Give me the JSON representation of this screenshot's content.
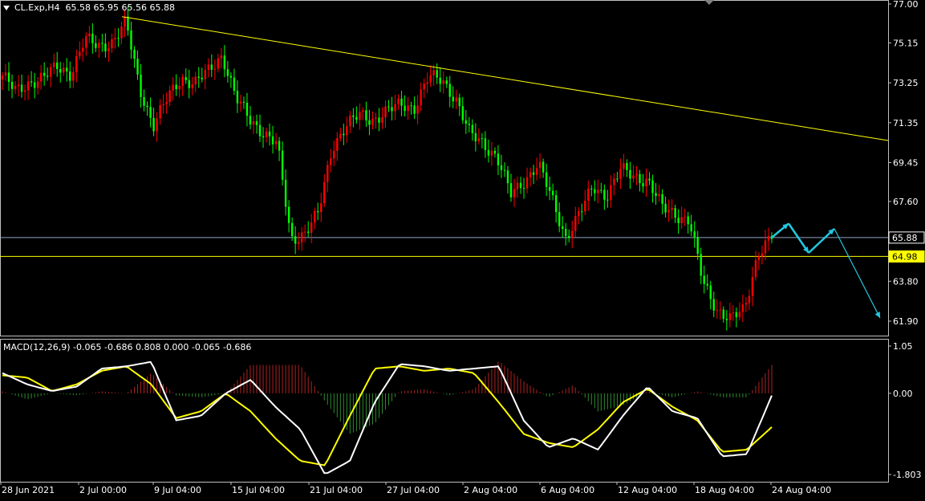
{
  "header": {
    "symbol": "CL.Exp,H4",
    "ohlc": "65.58 65.95 65.56 65.88"
  },
  "macd_header": "MACD(12,26,9) -0.065 -0.686 0.808 0.000 -0.065 -0.686",
  "colors": {
    "background": "#000000",
    "bull_candle": "#ff0000",
    "bear_candle": "#00ff00",
    "trendline": "#ffff00",
    "support_line": "#ffff00",
    "price_line": "#8fa4c4",
    "forecast_arrow": "#22c8e0",
    "macd_line": "#ffffff",
    "signal_line": "#ffff00",
    "hist_pos": "#b22222",
    "hist_neg": "#2e8b2e"
  },
  "price_badges": {
    "current": "65.88",
    "support": "64.98"
  },
  "chart_data": [
    {
      "type": "candlestick",
      "title": "CL.Exp,H4",
      "y_ticks": [
        "77.00",
        "75.15",
        "73.25",
        "71.35",
        "69.45",
        "67.60",
        "63.80",
        "61.90"
      ],
      "ylim": [
        61.4,
        77.0
      ],
      "x_ticks": [
        "28 Jun 2021",
        "2 Jul 00:00",
        "9 Jul 04:00",
        "15 Jul 04:00",
        "21 Jul 04:00",
        "27 Jul 04:00",
        "2 Aug 04:00",
        "6 Aug 04:00",
        "12 Aug 04:00",
        "18 Aug 04:00",
        "24 Aug 04:00"
      ],
      "close_path": [
        73.6,
        72.8,
        73.3,
        73.5,
        74.0,
        73.7,
        75.3,
        75.0,
        75.2,
        76.1,
        73.0,
        71.2,
        72.5,
        73.5,
        73.2,
        73.8,
        74.6,
        72.5,
        71.5,
        70.9,
        70.3,
        65.8,
        66.1,
        67.0,
        70.2,
        71.2,
        71.7,
        71.5,
        71.9,
        72.2,
        72.1,
        73.5,
        73.4,
        72.5,
        70.8,
        70.4,
        69.7,
        67.9,
        68.6,
        69.4,
        67.7,
        65.9,
        67.0,
        68.3,
        67.9,
        69.1,
        68.8,
        68.6,
        67.3,
        67.0,
        66.7,
        63.7,
        62.5,
        62.0,
        62.4,
        65.2,
        65.9
      ],
      "trendline": {
        "from": 76.4,
        "to": 70.5
      },
      "horizontal_lines": [
        65.88,
        64.98
      ],
      "forecast_path": [
        65.88,
        66.55,
        65.15,
        66.3,
        62.05
      ]
    },
    {
      "type": "macd",
      "title": "MACD(12,26,9)",
      "values": {
        "histogram": -0.065,
        "signal": -0.686,
        "osma": 0.808,
        "zero": 0.0
      },
      "y_ticks": [
        "1.05",
        "0.00",
        "-1.803"
      ],
      "ylim": [
        -1.803,
        1.05
      ],
      "macd_path": [
        0.45,
        0.2,
        0.05,
        0.15,
        0.55,
        0.6,
        0.7,
        -0.6,
        -0.5,
        0.0,
        0.3,
        -0.3,
        -0.8,
        -1.8,
        -1.5,
        -0.2,
        0.65,
        0.6,
        0.5,
        0.55,
        0.6,
        -0.6,
        -1.2,
        -1.0,
        -1.25,
        -0.5,
        0.15,
        -0.4,
        -0.55,
        -1.4,
        -1.35,
        -0.05
      ],
      "signal_path": [
        0.4,
        0.35,
        0.05,
        0.2,
        0.5,
        0.6,
        0.2,
        -0.55,
        -0.4,
        0.0,
        -0.4,
        -1.0,
        -1.5,
        -1.6,
        -0.5,
        0.55,
        0.6,
        0.5,
        0.55,
        0.45,
        -0.2,
        -0.9,
        -1.1,
        -1.2,
        -0.8,
        -0.2,
        0.1,
        -0.3,
        -0.6,
        -1.3,
        -1.25,
        -0.75
      ]
    }
  ]
}
